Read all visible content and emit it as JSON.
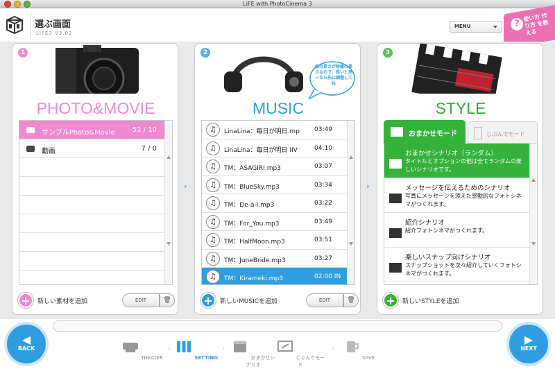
{
  "window": {
    "title": "LiFE with PhotoCinema 3"
  },
  "header": {
    "page_title": "選ぶ画面",
    "version": "LIFE3 V3.02",
    "menu_label": "MENU",
    "howto_text": "使い方 作り方 を教える"
  },
  "panels": {
    "photo": {
      "number": "1",
      "title": "PHOTO&MOVIE",
      "items": [
        {
          "label": "サンプルPhoto&Movie",
          "count": "51 / 10",
          "selected": true
        },
        {
          "label": "動画",
          "count": "7 / 0",
          "selected": false
        }
      ],
      "add_label": "新しい素材を追加",
      "edit_label": "EDIT"
    },
    "music": {
      "number": "2",
      "title": "MUSIC",
      "bubble": "曲の長さが映像の長さなので、長いと思ったら先に調整してね",
      "items": [
        {
          "label": "LinaLina：毎日が明日.mp",
          "duration": "03:49"
        },
        {
          "label": "LinaLina：毎日が明日 IIV",
          "duration": "04:10"
        },
        {
          "label": "TM：ASAGIRI.mp3",
          "duration": "03:07"
        },
        {
          "label": "TM：BlueSky.mp3",
          "duration": "03:34"
        },
        {
          "label": "TM：De-a-i.mp3",
          "duration": "03:22"
        },
        {
          "label": "TM：For_You.mp3",
          "duration": "03:49"
        },
        {
          "label": "TM：HalfMoon.mp3",
          "duration": "03:51"
        },
        {
          "label": "TM：JuneBride.mp3",
          "duration": "03:27"
        },
        {
          "label": "TM：Kirameki.mp3",
          "duration": "02:00 IN",
          "selected": true
        }
      ],
      "add_label": "新しいMUSICを追加",
      "edit_label": "EDIT"
    },
    "style": {
      "number": "3",
      "title": "STYLE",
      "tab_on": "おまかせモード",
      "tab_off": "じぶんでモード",
      "items": [
        {
          "title": "おまかせシナリオ（ランダム）",
          "desc": "タイトルとオプションの他は全てランダムの楽しいシナリオです。",
          "selected": true
        },
        {
          "title": "メッセージを伝えるためのシナリオ",
          "desc": "写真にメッセージを添えた感動的なフォトシネマがつくれます。"
        },
        {
          "title": "紹介シナリオ",
          "desc": "紹介フォトシネマがつくれます。"
        },
        {
          "title": "楽しいスナップ向けシナリオ",
          "desc": "スナップショットを次々紹介していくフォトシネマがつくれます。"
        }
      ],
      "add_label": "新しいSTYLEを追加"
    }
  },
  "nav": {
    "back": "BACK",
    "next": "NEXT",
    "steps": [
      {
        "label": "THEATER"
      },
      {
        "label": "SETTING",
        "active": true
      },
      {
        "label": "おまかせシナリオ"
      },
      {
        "label": "じぶんでモード"
      },
      {
        "label": "SAVE"
      }
    ]
  },
  "colors": {
    "photo": "#f08ad0",
    "music": "#2f9ee0",
    "style": "#35b23a"
  }
}
